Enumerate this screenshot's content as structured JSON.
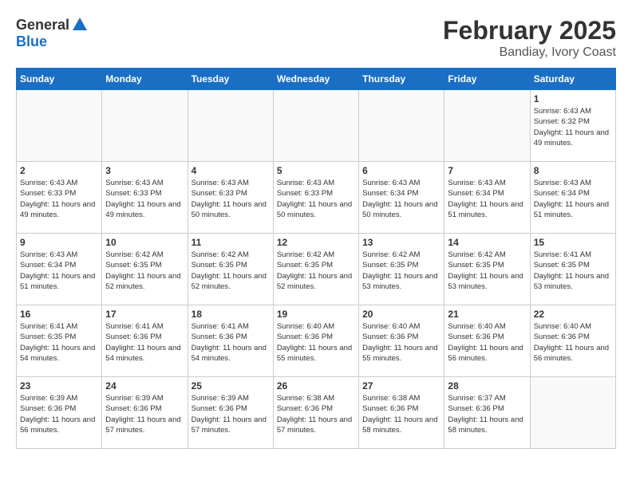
{
  "header": {
    "logo_general": "General",
    "logo_blue": "Blue",
    "title": "February 2025",
    "subtitle": "Bandiay, Ivory Coast"
  },
  "days_of_week": [
    "Sunday",
    "Monday",
    "Tuesday",
    "Wednesday",
    "Thursday",
    "Friday",
    "Saturday"
  ],
  "weeks": [
    [
      {
        "day": "",
        "info": ""
      },
      {
        "day": "",
        "info": ""
      },
      {
        "day": "",
        "info": ""
      },
      {
        "day": "",
        "info": ""
      },
      {
        "day": "",
        "info": ""
      },
      {
        "day": "",
        "info": ""
      },
      {
        "day": "1",
        "info": "Sunrise: 6:43 AM\nSunset: 6:32 PM\nDaylight: 11 hours and 49 minutes."
      }
    ],
    [
      {
        "day": "2",
        "info": "Sunrise: 6:43 AM\nSunset: 6:33 PM\nDaylight: 11 hours and 49 minutes."
      },
      {
        "day": "3",
        "info": "Sunrise: 6:43 AM\nSunset: 6:33 PM\nDaylight: 11 hours and 49 minutes."
      },
      {
        "day": "4",
        "info": "Sunrise: 6:43 AM\nSunset: 6:33 PM\nDaylight: 11 hours and 50 minutes."
      },
      {
        "day": "5",
        "info": "Sunrise: 6:43 AM\nSunset: 6:33 PM\nDaylight: 11 hours and 50 minutes."
      },
      {
        "day": "6",
        "info": "Sunrise: 6:43 AM\nSunset: 6:34 PM\nDaylight: 11 hours and 50 minutes."
      },
      {
        "day": "7",
        "info": "Sunrise: 6:43 AM\nSunset: 6:34 PM\nDaylight: 11 hours and 51 minutes."
      },
      {
        "day": "8",
        "info": "Sunrise: 6:43 AM\nSunset: 6:34 PM\nDaylight: 11 hours and 51 minutes."
      }
    ],
    [
      {
        "day": "9",
        "info": "Sunrise: 6:43 AM\nSunset: 6:34 PM\nDaylight: 11 hours and 51 minutes."
      },
      {
        "day": "10",
        "info": "Sunrise: 6:42 AM\nSunset: 6:35 PM\nDaylight: 11 hours and 52 minutes."
      },
      {
        "day": "11",
        "info": "Sunrise: 6:42 AM\nSunset: 6:35 PM\nDaylight: 11 hours and 52 minutes."
      },
      {
        "day": "12",
        "info": "Sunrise: 6:42 AM\nSunset: 6:35 PM\nDaylight: 11 hours and 52 minutes."
      },
      {
        "day": "13",
        "info": "Sunrise: 6:42 AM\nSunset: 6:35 PM\nDaylight: 11 hours and 53 minutes."
      },
      {
        "day": "14",
        "info": "Sunrise: 6:42 AM\nSunset: 6:35 PM\nDaylight: 11 hours and 53 minutes."
      },
      {
        "day": "15",
        "info": "Sunrise: 6:41 AM\nSunset: 6:35 PM\nDaylight: 11 hours and 53 minutes."
      }
    ],
    [
      {
        "day": "16",
        "info": "Sunrise: 6:41 AM\nSunset: 6:35 PM\nDaylight: 11 hours and 54 minutes."
      },
      {
        "day": "17",
        "info": "Sunrise: 6:41 AM\nSunset: 6:36 PM\nDaylight: 11 hours and 54 minutes."
      },
      {
        "day": "18",
        "info": "Sunrise: 6:41 AM\nSunset: 6:36 PM\nDaylight: 11 hours and 54 minutes."
      },
      {
        "day": "19",
        "info": "Sunrise: 6:40 AM\nSunset: 6:36 PM\nDaylight: 11 hours and 55 minutes."
      },
      {
        "day": "20",
        "info": "Sunrise: 6:40 AM\nSunset: 6:36 PM\nDaylight: 11 hours and 55 minutes."
      },
      {
        "day": "21",
        "info": "Sunrise: 6:40 AM\nSunset: 6:36 PM\nDaylight: 11 hours and 56 minutes."
      },
      {
        "day": "22",
        "info": "Sunrise: 6:40 AM\nSunset: 6:36 PM\nDaylight: 11 hours and 56 minutes."
      }
    ],
    [
      {
        "day": "23",
        "info": "Sunrise: 6:39 AM\nSunset: 6:36 PM\nDaylight: 11 hours and 56 minutes."
      },
      {
        "day": "24",
        "info": "Sunrise: 6:39 AM\nSunset: 6:36 PM\nDaylight: 11 hours and 57 minutes."
      },
      {
        "day": "25",
        "info": "Sunrise: 6:39 AM\nSunset: 6:36 PM\nDaylight: 11 hours and 57 minutes."
      },
      {
        "day": "26",
        "info": "Sunrise: 6:38 AM\nSunset: 6:36 PM\nDaylight: 11 hours and 57 minutes."
      },
      {
        "day": "27",
        "info": "Sunrise: 6:38 AM\nSunset: 6:36 PM\nDaylight: 11 hours and 58 minutes."
      },
      {
        "day": "28",
        "info": "Sunrise: 6:37 AM\nSunset: 6:36 PM\nDaylight: 11 hours and 58 minutes."
      },
      {
        "day": "",
        "info": ""
      }
    ]
  ]
}
